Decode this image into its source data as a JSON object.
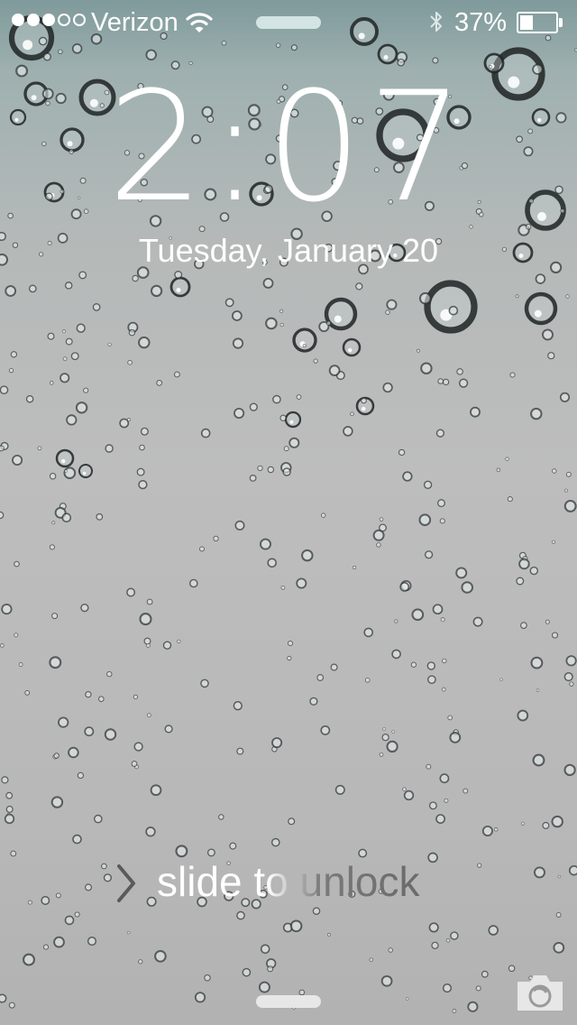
{
  "status_bar": {
    "signal_dots_filled": 3,
    "signal_dots_total": 5,
    "carrier": "Verizon",
    "wifi_icon": "wifi-icon",
    "bluetooth_icon": "bluetooth-icon",
    "battery_percent": "37%",
    "battery_level": 0.37
  },
  "lock_screen": {
    "time": "2:07",
    "date": "Tuesday, January 20",
    "slide_label": "slide to unlock",
    "chevron_icon": "chevron-right-icon",
    "camera_icon": "camera-icon"
  },
  "colors": {
    "text": "#ffffff",
    "wallpaper_top": "#7f9a9b",
    "wallpaper_bottom": "#b2b2b2"
  }
}
